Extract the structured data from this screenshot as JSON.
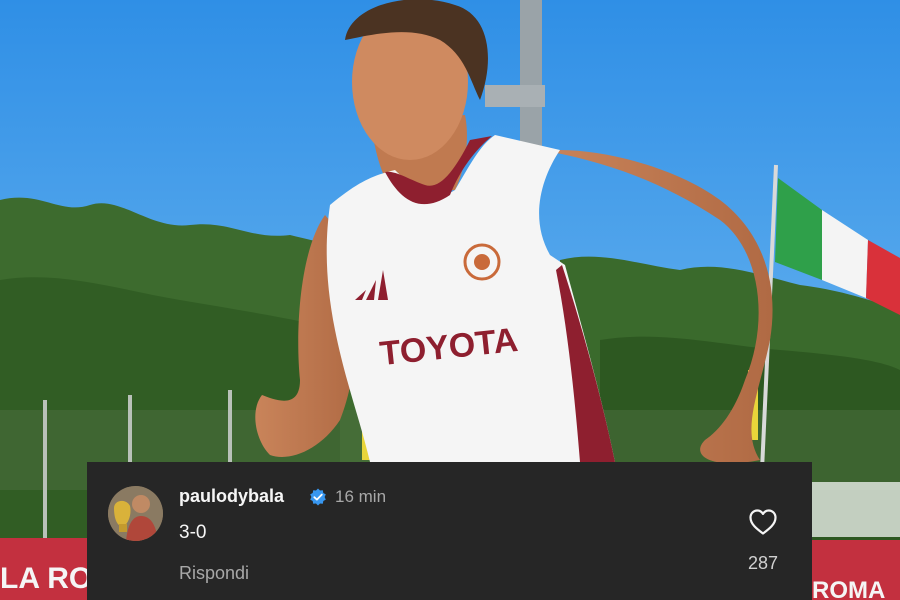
{
  "photo": {
    "jersey_sponsor": "TOYOTA",
    "banner_left": "LA ROMA",
    "banner_right": "ROMA"
  },
  "comment": {
    "username": "paulodybala",
    "timestamp": "16 min",
    "text": "3-0",
    "reply_label": "Rispondi",
    "likes": "287"
  },
  "icons": {
    "verified": "verified-badge-icon",
    "like": "heart-outline-icon"
  },
  "colors": {
    "card_bg": "#262626",
    "verified_blue": "#3897f0",
    "roma_red": "#8e1f2f"
  }
}
